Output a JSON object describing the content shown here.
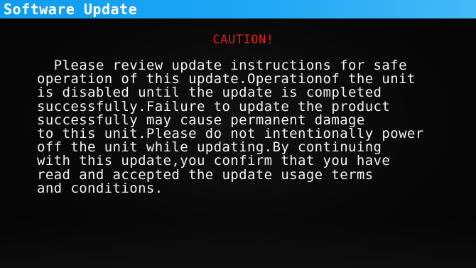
{
  "window": {
    "title": "Software Update"
  },
  "dialog": {
    "heading": "CAUTION!",
    "lines": [
      "  Please review update instructions for safe",
      "operation of this update.Operationof the unit",
      "is disabled until the update is completed",
      "successfully.Failure to update the product",
      "successfully may cause permanent damage",
      "to this unit.Please do not intentionally power",
      "off the unit while updating.By continuing",
      "with this update,you confirm that you have",
      "read and accepted the update usage terms",
      "and conditions."
    ]
  },
  "colors": {
    "titlebar": "#1fa8f5",
    "heading": "#e01e1e",
    "text": "#f2f2f2",
    "background": "#070707"
  }
}
